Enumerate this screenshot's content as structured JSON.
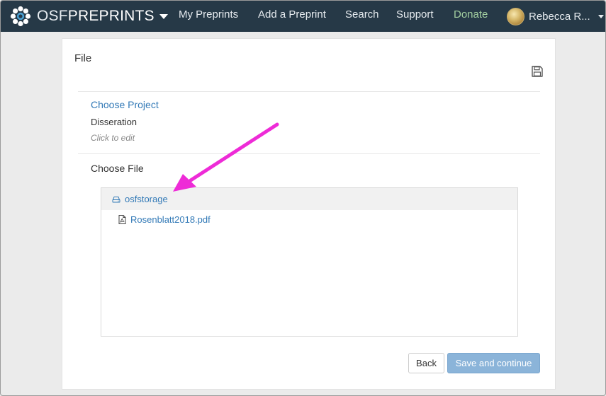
{
  "navbar": {
    "brand_osf": "OSF",
    "brand_preprints": "PREPRINTS",
    "links": [
      {
        "label": "My Preprints"
      },
      {
        "label": "Add a Preprint"
      },
      {
        "label": "Search"
      },
      {
        "label": "Support"
      },
      {
        "label": "Donate"
      }
    ],
    "user_name": "Rebecca R..."
  },
  "panel": {
    "title": "File",
    "choose_project": "Choose Project",
    "project_name": "Disseration",
    "click_to_edit": "Click to edit",
    "choose_file": "Choose File",
    "storage_label": "osfstorage",
    "file_name": "Rosenblatt2018.pdf",
    "back_label": "Back",
    "save_label": "Save and continue"
  },
  "colors": {
    "navbar_bg": "#263947",
    "link_blue": "#337ab7",
    "donate_green": "#a4d0a1",
    "save_button": "#8bb4d9",
    "annotation_arrow": "#ee2bd7"
  },
  "icons": {
    "logo": "osf-flower-logo",
    "brand_caret": "caret-down-icon",
    "user_caret": "caret-down-icon",
    "save": "floppy-disk-icon",
    "storage": "hard-drive-icon",
    "file": "pdf-file-icon"
  }
}
